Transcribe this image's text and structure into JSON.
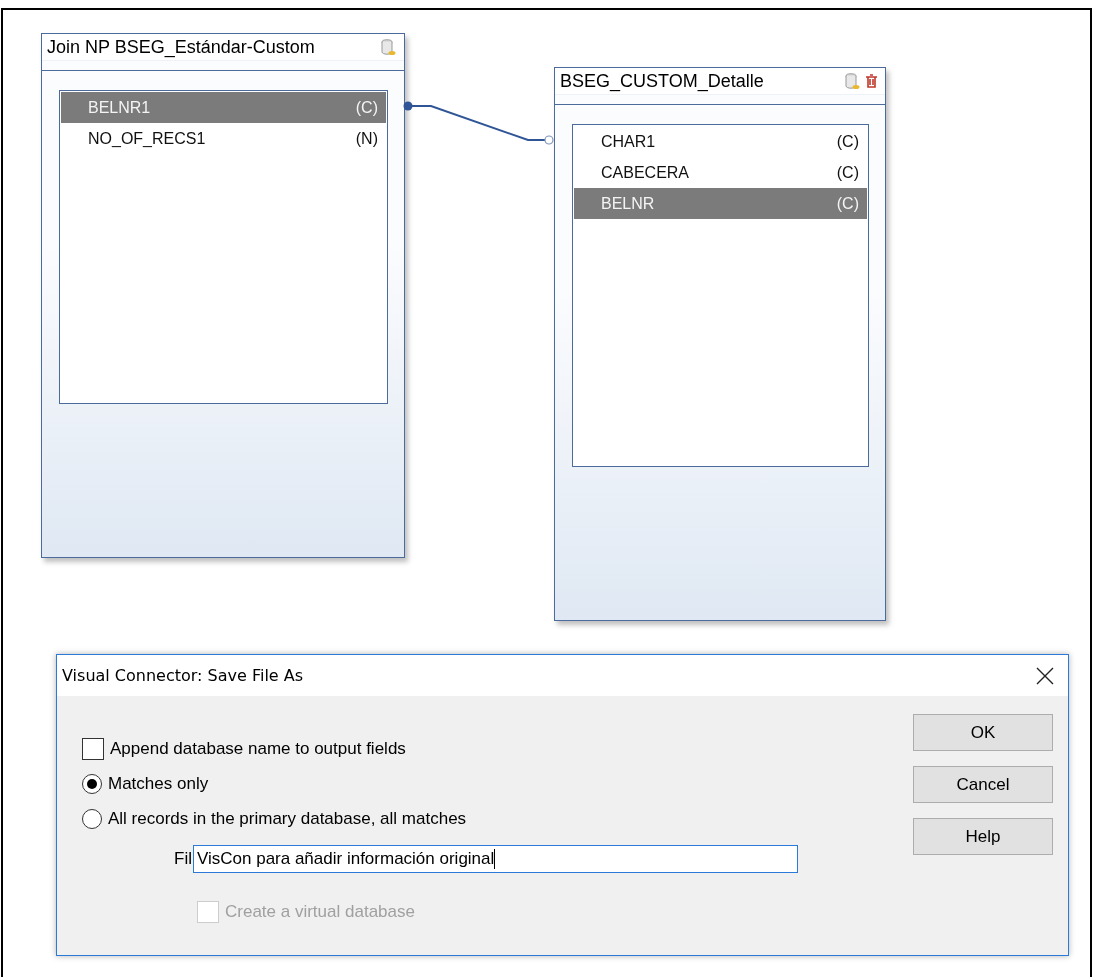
{
  "tables": [
    {
      "title": "Join NP BSEG_Estándar-Custom",
      "deletable": false,
      "fields": [
        {
          "name": "BELNR1",
          "type": "(C)",
          "selected": true
        },
        {
          "name": "NO_OF_RECS1",
          "type": "(N)",
          "selected": false
        }
      ]
    },
    {
      "title": "BSEG_CUSTOM_Detalle",
      "deletable": true,
      "fields": [
        {
          "name": "CHAR1",
          "type": "(C)",
          "selected": false
        },
        {
          "name": "CABECERA",
          "type": "(C)",
          "selected": false
        },
        {
          "name": "BELNR",
          "type": "(C)",
          "selected": true
        }
      ]
    }
  ],
  "dialog": {
    "title": "Visual Connector: Save File As",
    "options": [
      {
        "kind": "checkbox",
        "label": "Append database name to output fields",
        "checked": false
      },
      {
        "kind": "radio",
        "label": "Matches only",
        "selected": true
      },
      {
        "kind": "radio",
        "label": "All records in the primary database, all matches",
        "selected": false
      }
    ],
    "file_label": "Fil",
    "file_value": "VisCon para añadir información original",
    "virtual": {
      "label": "Create a virtual database",
      "checked": false,
      "disabled": true
    },
    "buttons": [
      "OK",
      "Cancel",
      "Help"
    ]
  }
}
